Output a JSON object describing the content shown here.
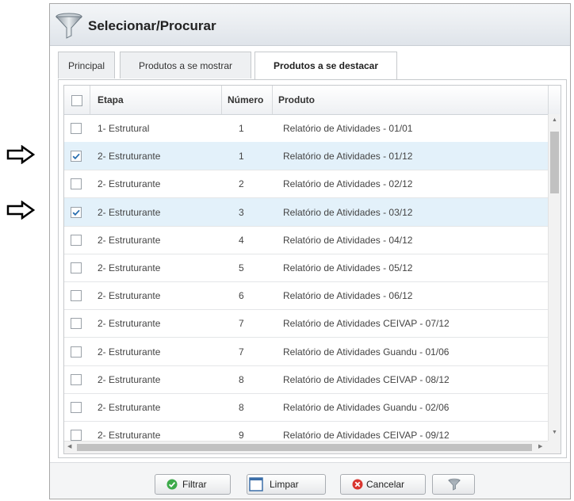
{
  "window": {
    "title": "Selecionar/Procurar",
    "icon": "funnel-icon"
  },
  "tabs": [
    {
      "label": "Principal",
      "active": false
    },
    {
      "label": "Produtos a se mostrar",
      "active": false
    },
    {
      "label": "Produtos a se destacar",
      "active": true
    }
  ],
  "grid": {
    "columns": [
      "Etapa",
      "Número",
      "Produto"
    ],
    "rows": [
      {
        "checked": false,
        "etapa": "1- Estrutural",
        "numero": "1",
        "produto": "Relatório de Atividades - 01/01"
      },
      {
        "checked": true,
        "etapa": "2- Estruturante",
        "numero": "1",
        "produto": "Relatório de Atividades - 01/12"
      },
      {
        "checked": false,
        "etapa": "2- Estruturante",
        "numero": "2",
        "produto": "Relatório de Atividades - 02/12"
      },
      {
        "checked": true,
        "etapa": "2- Estruturante",
        "numero": "3",
        "produto": "Relatório de Atividades - 03/12"
      },
      {
        "checked": false,
        "etapa": "2- Estruturante",
        "numero": "4",
        "produto": "Relatório de Atividades - 04/12"
      },
      {
        "checked": false,
        "etapa": "2- Estruturante",
        "numero": "5",
        "produto": "Relatório de Atividades - 05/12"
      },
      {
        "checked": false,
        "etapa": "2- Estruturante",
        "numero": "6",
        "produto": "Relatório de Atividades - 06/12"
      },
      {
        "checked": false,
        "etapa": "2- Estruturante",
        "numero": "7",
        "produto": "Relatório de Atividades CEIVAP - 07/12"
      },
      {
        "checked": false,
        "etapa": "2- Estruturante",
        "numero": "7",
        "produto": "Relatório de Atividades Guandu - 01/06"
      },
      {
        "checked": false,
        "etapa": "2- Estruturante",
        "numero": "8",
        "produto": "Relatório de Atividades CEIVAP - 08/12"
      },
      {
        "checked": false,
        "etapa": "2- Estruturante",
        "numero": "8",
        "produto": "Relatório de Atividades Guandu - 02/06"
      },
      {
        "checked": false,
        "etapa": "2- Estruturante",
        "numero": "9",
        "produto": "Relatório de Atividades CEIVAP - 09/12"
      }
    ]
  },
  "buttons": {
    "filter": {
      "label": "Filtrar",
      "icon": "check-circle-icon"
    },
    "clear": {
      "label": "Limpar",
      "icon": "blank-document-icon"
    },
    "cancel": {
      "label": "Cancelar",
      "icon": "cancel-circle-icon"
    },
    "funnel": {
      "icon": "funnel-icon"
    }
  },
  "colors": {
    "selected_row": "#e3f1fa",
    "check": "#2a6fb0",
    "filter_icon": "#3daa4a",
    "cancel_icon": "#d9352f"
  }
}
